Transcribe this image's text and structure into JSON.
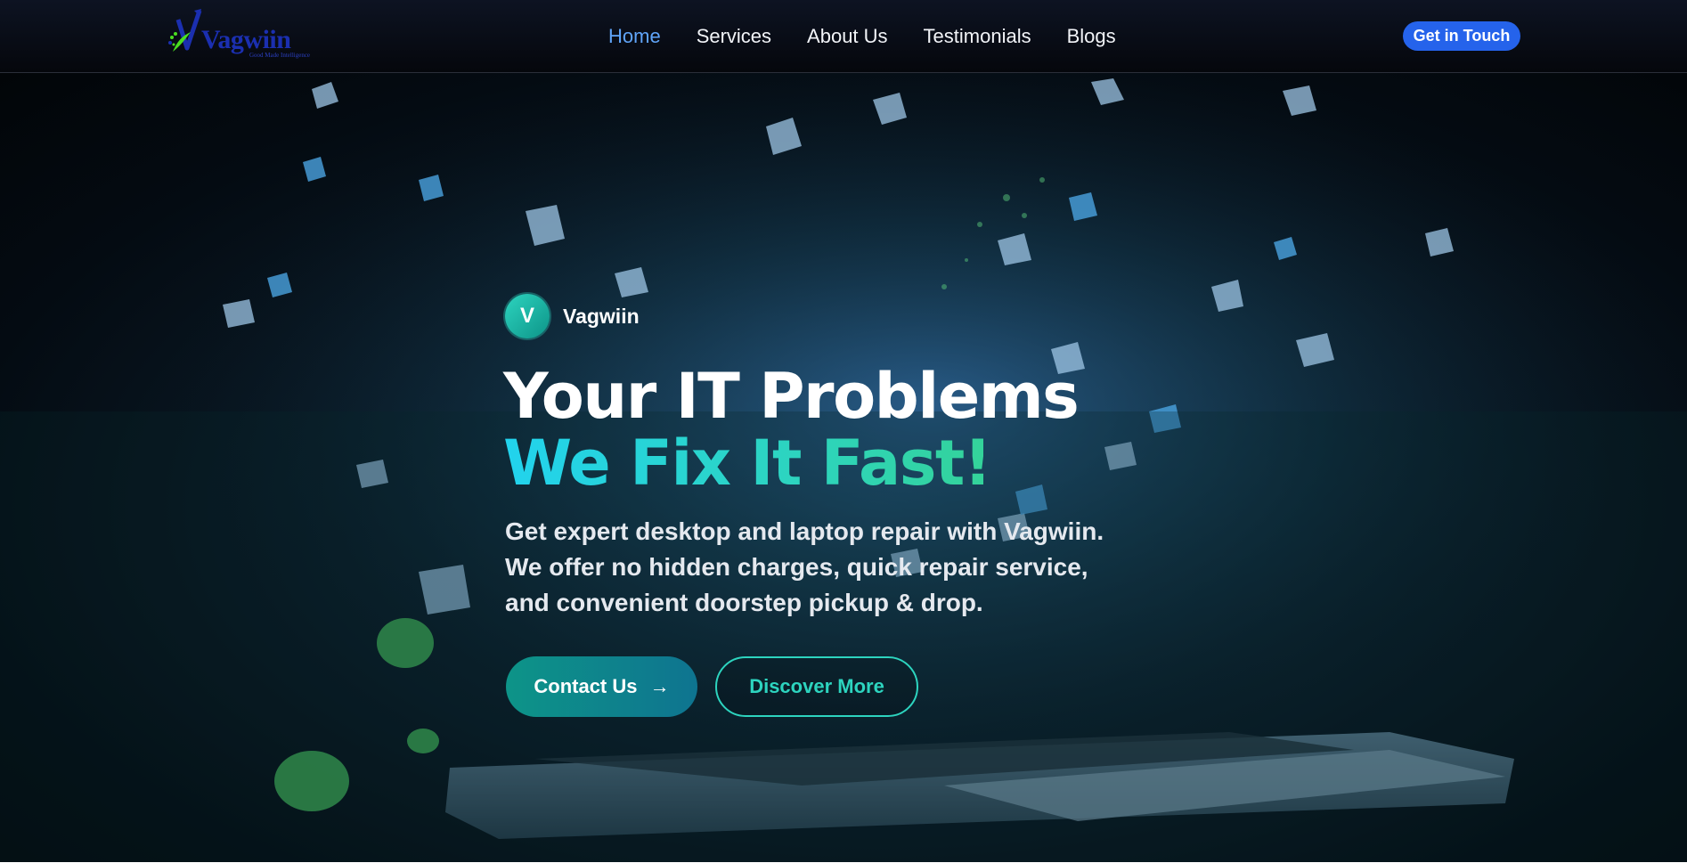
{
  "header": {
    "logo": {
      "text": "Vagwiin",
      "tagline": "Good Made Intelligence"
    },
    "nav": [
      {
        "label": "Home",
        "active": true
      },
      {
        "label": "Services",
        "active": false
      },
      {
        "label": "About Us",
        "active": false
      },
      {
        "label": "Testimonials",
        "active": false
      },
      {
        "label": "Blogs",
        "active": false
      }
    ],
    "cta_label": "Get in Touch"
  },
  "hero": {
    "brand_initial": "V",
    "brand_name": "Vagwiin",
    "headline_line1": "Your IT Problems",
    "headline_line2": "We Fix It Fast!",
    "subtext": [
      "Get expert desktop and laptop repair with Vagwiin.",
      "We offer no hidden charges, quick repair service,",
      "and convenient doorstep pickup & drop."
    ],
    "primary_button": "Contact Us",
    "primary_button_icon": "arrow-right-icon",
    "secondary_button": "Discover More"
  },
  "colors": {
    "accent_blue": "#2563eb",
    "nav_active": "#60a5fa",
    "teal": "#2dd4bf",
    "cyan": "#22d3ee",
    "header_bg": "#05070c"
  }
}
